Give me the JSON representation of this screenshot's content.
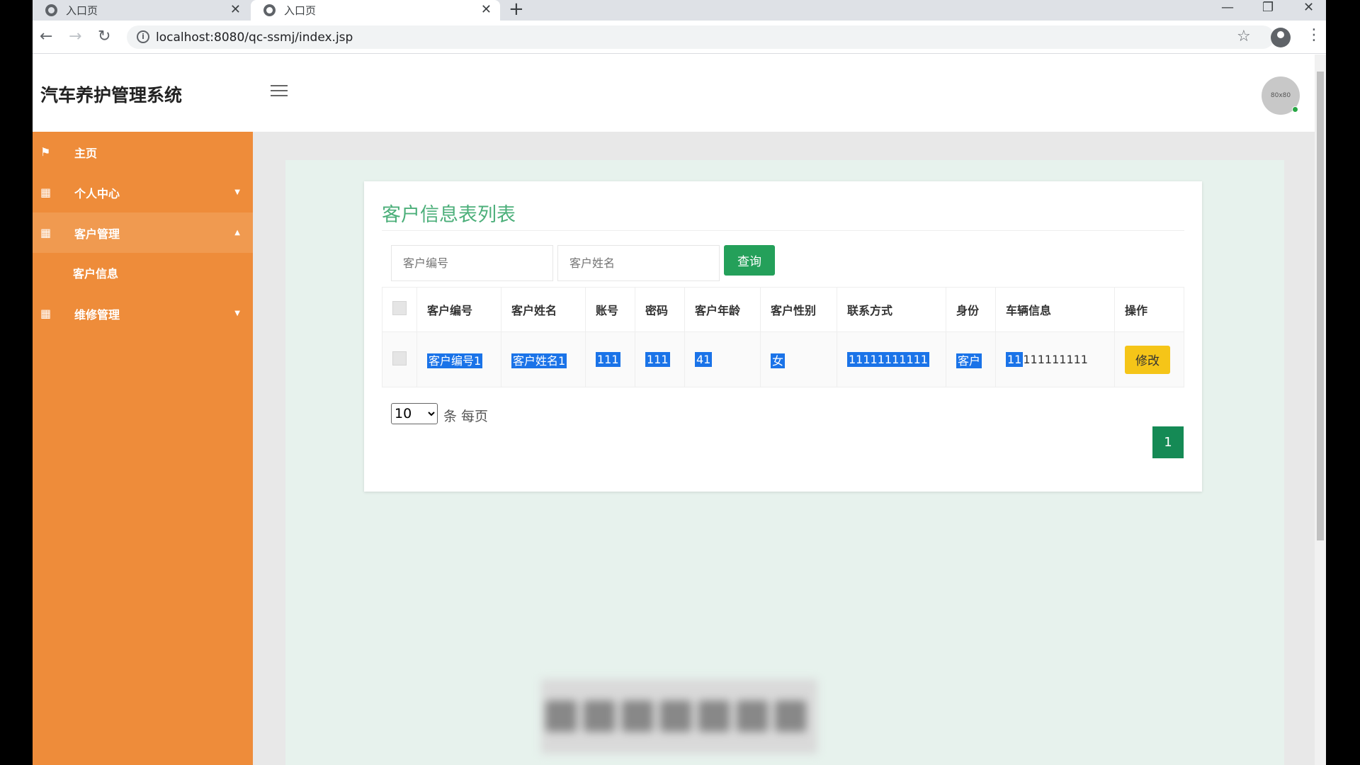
{
  "browser": {
    "tabs": [
      {
        "title": "入口页",
        "active": false
      },
      {
        "title": "入口页",
        "active": true
      }
    ],
    "url": "localhost:8080/qc-ssmj/index.jsp"
  },
  "header": {
    "title": "汽车养护管理系统",
    "avatar_text": "80x80"
  },
  "sidebar": {
    "items": [
      {
        "label": "主页",
        "icon": "flag-icon"
      },
      {
        "label": "个人中心",
        "icon": "grid-icon",
        "expanded": false
      },
      {
        "label": "客户管理",
        "icon": "grid-icon",
        "expanded": true
      },
      {
        "label": "维修管理",
        "icon": "grid-icon",
        "expanded": false
      }
    ],
    "subitems": [
      {
        "label": "客户信息"
      }
    ]
  },
  "main": {
    "title": "客户信息表列表",
    "search": {
      "customer_no_placeholder": "客户编号",
      "customer_name_placeholder": "客户姓名",
      "query_label": "查询"
    },
    "table": {
      "headers": [
        "客户编号",
        "客户姓名",
        "账号",
        "密码",
        "客户年龄",
        "客户性别",
        "联系方式",
        "身份",
        "车辆信息",
        "操作"
      ],
      "rows": [
        {
          "customer_no": "客户编号1",
          "customer_name": "客户姓名1",
          "account": "111",
          "password": "111",
          "age": "41",
          "gender": "女",
          "phone": "11111111111",
          "role": "客户",
          "vehicle_sel": "11",
          "vehicle_rest": "111111111",
          "edit_label": "修改"
        }
      ]
    },
    "pagination": {
      "page_size": "10",
      "page_size_suffix": "条 每页",
      "current_page": "1"
    }
  },
  "colors": {
    "sidebar": "#ee8c3a",
    "accent_green": "#24a05a",
    "edit_yellow": "#f5c518",
    "selection_blue": "#1a73e8"
  }
}
